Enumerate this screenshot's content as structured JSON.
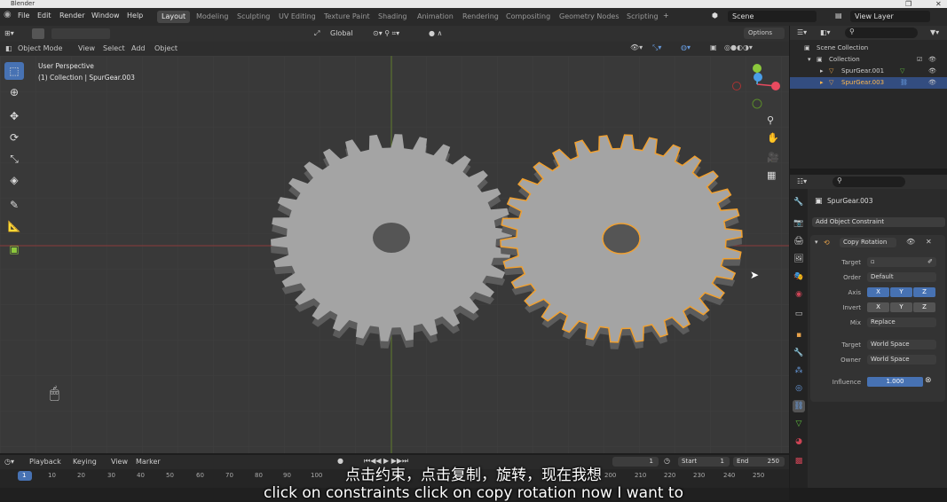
{
  "app": {
    "title": "Blender"
  },
  "menus": [
    "File",
    "Edit",
    "Render",
    "Window",
    "Help"
  ],
  "workspaces": [
    "Layout",
    "Modeling",
    "Sculpting",
    "UV Editing",
    "Texture Paint",
    "Shading",
    "Animation",
    "Rendering",
    "Compositing",
    "Geometry Nodes",
    "Scripting"
  ],
  "scene": {
    "label": "Scene",
    "view_layer": "View Layer"
  },
  "viewport_header": {
    "mode": "Object Mode",
    "menu": [
      "View",
      "Select",
      "Add",
      "Object"
    ],
    "transform": "Global",
    "options": "Options"
  },
  "viewport": {
    "perspective": "User Perspective",
    "collection_info": "(1) Collection | SpurGear.003"
  },
  "outliner": {
    "items": [
      {
        "name": "Scene Collection"
      },
      {
        "name": "Collection"
      },
      {
        "name": "SpurGear.001"
      },
      {
        "name": "SpurGear.003"
      }
    ]
  },
  "properties": {
    "object_name": "SpurGear.003",
    "add_constraint": "Add Object Constraint",
    "constraint_name": "Copy Rotation",
    "target_label": "Target",
    "order_label": "Order",
    "order_value": "Default",
    "axis_label": "Axis",
    "invert_label": "Invert",
    "mix_label": "Mix",
    "mix_value": "Replace",
    "target_space_label": "Target",
    "target_space_value": "World Space",
    "owner_label": "Owner",
    "owner_value": "World Space",
    "influence_label": "Influence",
    "influence_value": "1.000",
    "x": "X",
    "y": "Y",
    "z": "Z"
  },
  "timeline": {
    "menus": [
      "Playback",
      "Keying",
      "View",
      "Marker"
    ],
    "current_frame": "1",
    "start_label": "Start",
    "start_value": "1",
    "end_label": "End",
    "end_value": "250",
    "ticks": [
      "1",
      "10",
      "20",
      "30",
      "40",
      "50",
      "60",
      "70",
      "80",
      "90",
      "100",
      "200",
      "210",
      "220",
      "230",
      "240",
      "250"
    ]
  },
  "subtitles": {
    "zh": "点击约束，点击复制，旋转，现在我想",
    "en": "click on constraints click on copy rotation now I want to"
  }
}
